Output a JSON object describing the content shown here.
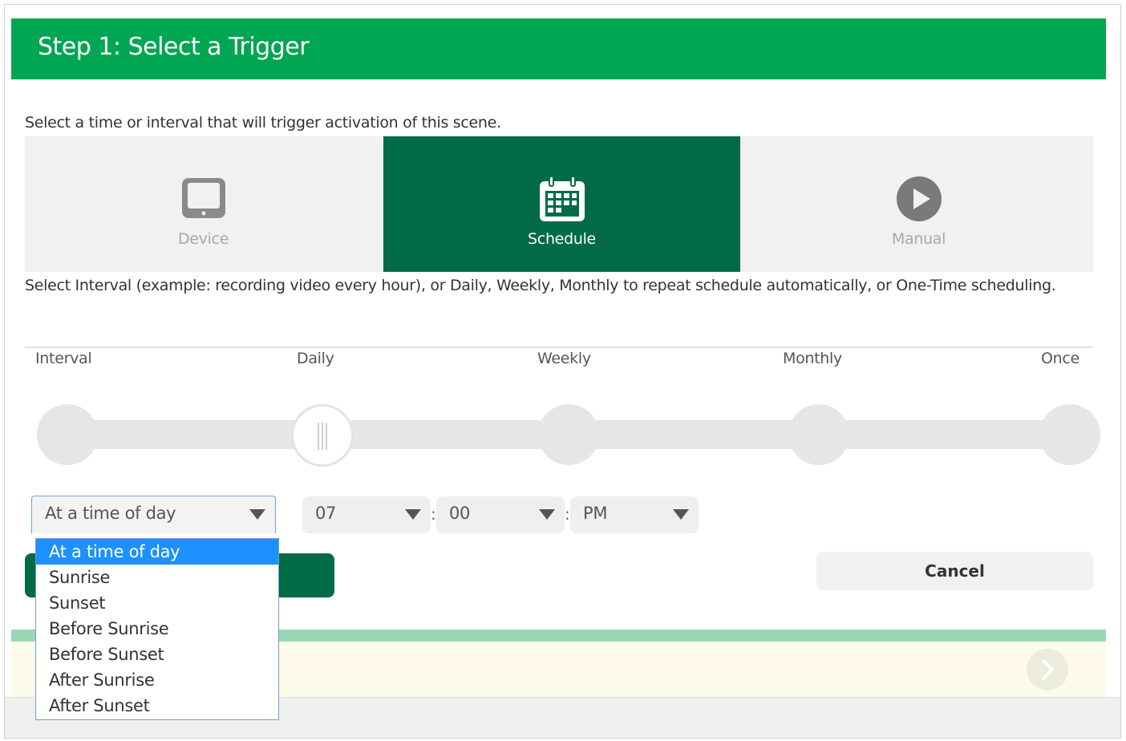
{
  "header": {
    "title": "Step 1: Select a Trigger"
  },
  "intro": "Select a time or interval that will trigger activation of this scene.",
  "triggers": [
    {
      "label": "Device",
      "icon": "tablet-icon"
    },
    {
      "label": "Schedule",
      "icon": "calendar-icon",
      "active": true
    },
    {
      "label": "Manual",
      "icon": "play-icon"
    }
  ],
  "description": "Select Interval (example: recording video every hour), or Daily, Weekly, Monthly to repeat schedule automatically, or One-Time scheduling.",
  "slider": {
    "labels": [
      "Interval",
      "Daily",
      "Weekly",
      "Monthly",
      "Once"
    ],
    "selected": "Daily"
  },
  "time": {
    "mode_value": "At a time of day",
    "hour": "07",
    "minute": "00",
    "ampm": "PM",
    "separator": ":",
    "options": [
      "At a time of day",
      "Sunrise",
      "Sunset",
      "Before Sunrise",
      "Before Sunset",
      "After Sunrise",
      "After Sunset"
    ]
  },
  "actions": {
    "cancel_label": "Cancel"
  },
  "colors": {
    "header": "#00a651",
    "accent_dark": "#006b45",
    "dropdown_highlight": "#1e90ff"
  }
}
